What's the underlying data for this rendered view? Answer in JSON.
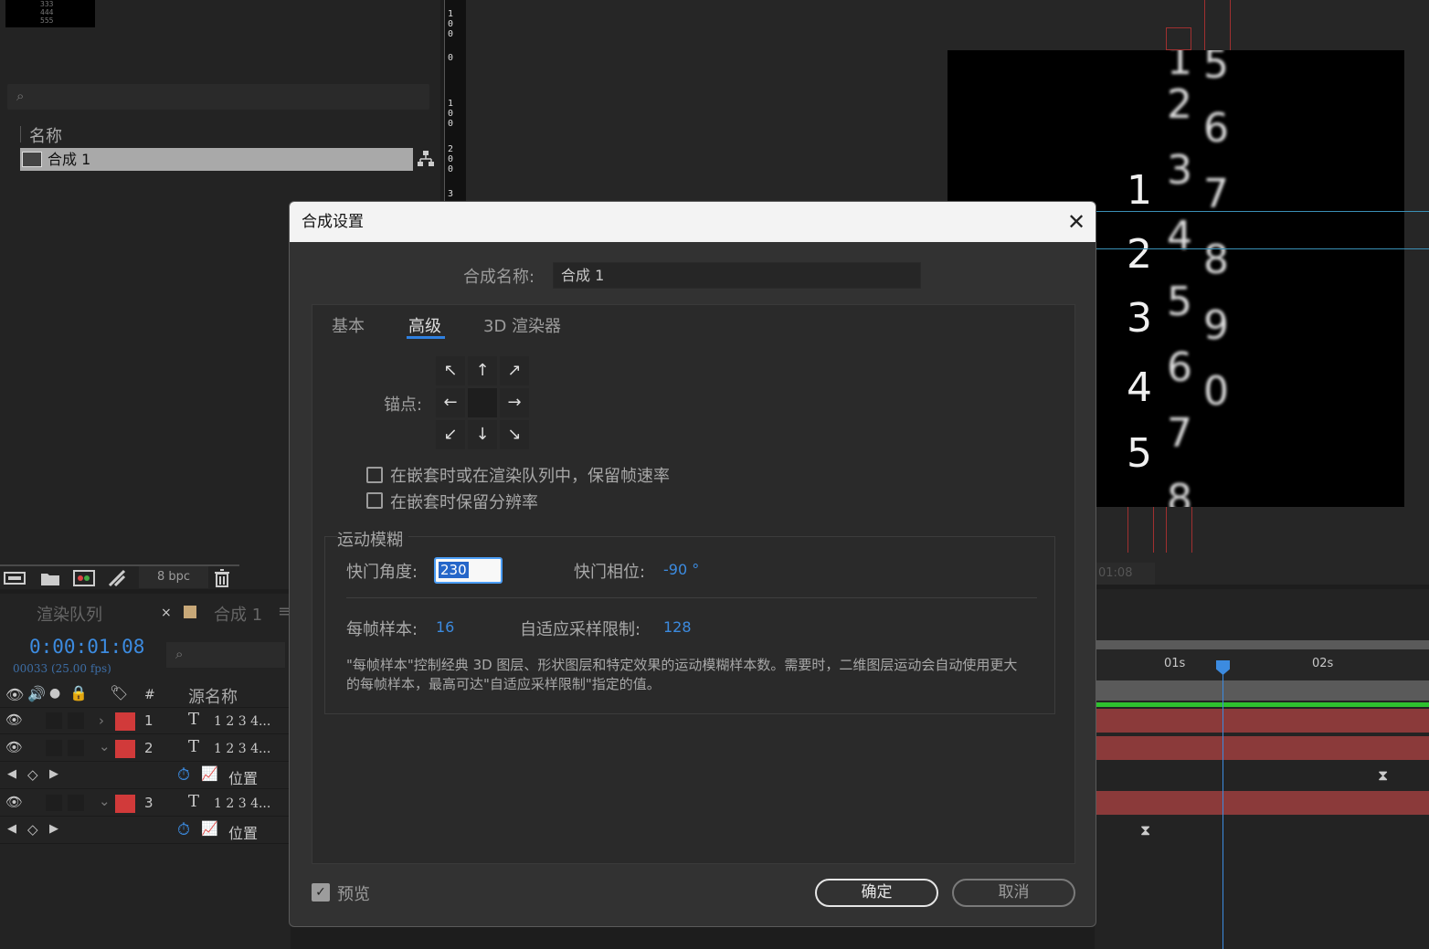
{
  "project": {
    "thumb_lines": [
      "333",
      "444",
      "555"
    ],
    "search_icon": "search-icon",
    "column_name": "名称",
    "item_name": "合成 1",
    "bpc": "8 bpc"
  },
  "ruler": {
    "labels": [
      "1",
      "0",
      "0",
      "0",
      "1",
      "0",
      "0",
      "2",
      "0",
      "0",
      "3"
    ]
  },
  "viewer": {
    "digits_col1": [
      "1",
      "2",
      "3",
      "4",
      "5"
    ],
    "digits_col2": [
      "1",
      "2",
      "3",
      "4",
      "5",
      "6",
      "7",
      "8"
    ],
    "digits_col3": [
      "5",
      "6",
      "7",
      "8",
      "9",
      "0"
    ],
    "timecode_small": "01:08"
  },
  "timeline": {
    "tab_render_queue": "渲染队列",
    "tab_comp": "合成 1",
    "timecode": "0:00:01:08",
    "frames": "00033 (25.00 fps)",
    "header_hash": "#",
    "header_source": "源名称",
    "layers": [
      {
        "num": "1",
        "text": "1 2 3 4..."
      },
      {
        "num": "2",
        "text": "1 2 3 4..."
      },
      {
        "num": "3",
        "text": "1 2 3 4..."
      }
    ],
    "property_label": "位置",
    "ruler_01s": "01s",
    "ruler_02s": "02s"
  },
  "dialog": {
    "title": "合成设置",
    "name_label": "合成名称:",
    "name_value": "合成 1",
    "tabs": [
      "基本",
      "高级",
      "3D 渲染器"
    ],
    "anchor_label": "锚点:",
    "check_preserve_framerate": "在嵌套时或在渲染队列中，保留帧速率",
    "check_preserve_resolution": "在嵌套时保留分辨率",
    "motion_blur_label": "运动模糊",
    "shutter_angle_label": "快门角度:",
    "shutter_angle_value": "230",
    "shutter_phase_label": "快门相位:",
    "shutter_phase_value": "-90 °",
    "samples_label": "每帧样本:",
    "samples_value": "16",
    "adaptive_label": "自适应采样限制:",
    "adaptive_value": "128",
    "description": "\"每帧样本\"控制经典 3D 图层、形状图层和特定效果的运动模糊样本数。需要时，二维图层运动会自动使用更大的每帧样本，最高可达\"自适应采样限制\"指定的值。",
    "preview_label": "预览",
    "ok_label": "确定",
    "cancel_label": "取消"
  },
  "colors": {
    "accent": "#3c8be0",
    "layer_label": "#d13a3a",
    "dialog_bg": "#323232"
  }
}
